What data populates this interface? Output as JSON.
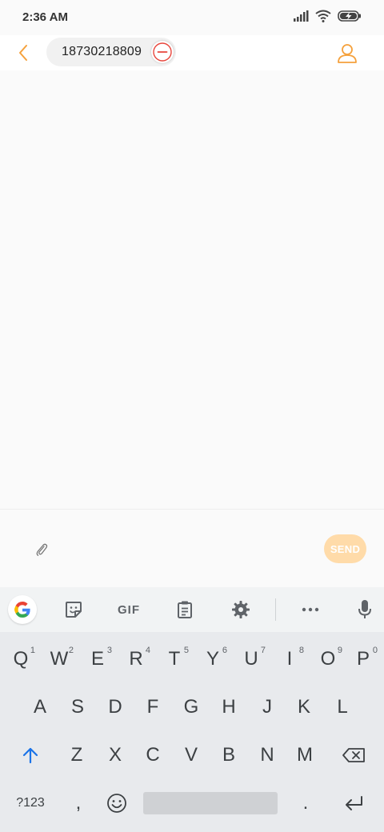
{
  "status_bar": {
    "time": "2:36 AM",
    "icons": [
      "signal-icon",
      "wifi-icon",
      "battery-charging-icon"
    ]
  },
  "header": {
    "back_icon": "chevron-left-icon",
    "recipient": "18730218809",
    "remove_icon": "minus-circle-icon",
    "contact_icon": "person-icon"
  },
  "composer": {
    "attach_icon": "paperclip-icon",
    "message_value": "",
    "send_label": "SEND"
  },
  "keyboard_toolbar": {
    "items": [
      "google-icon",
      "sticker-icon",
      "gif-button",
      "clipboard-icon",
      "gear-icon",
      "more-icon",
      "mic-icon"
    ],
    "gif_label": "GIF"
  },
  "keyboard": {
    "row1": [
      {
        "label": "Q",
        "hint": "1"
      },
      {
        "label": "W",
        "hint": "2"
      },
      {
        "label": "E",
        "hint": "3"
      },
      {
        "label": "R",
        "hint": "4"
      },
      {
        "label": "T",
        "hint": "5"
      },
      {
        "label": "Y",
        "hint": "6"
      },
      {
        "label": "U",
        "hint": "7"
      },
      {
        "label": "I",
        "hint": "8"
      },
      {
        "label": "O",
        "hint": "9"
      },
      {
        "label": "P",
        "hint": "0"
      }
    ],
    "row2": [
      "A",
      "S",
      "D",
      "F",
      "G",
      "H",
      "J",
      "K",
      "L"
    ],
    "row3": [
      "Z",
      "X",
      "C",
      "V",
      "B",
      "N",
      "M"
    ],
    "symbols_label": "?123",
    "comma_label": ",",
    "period_label": "."
  },
  "colors": {
    "accent": "#f5a13c",
    "send_disabled": "#ffdba9",
    "remove_red": "#e8453c",
    "shift_blue": "#1a73e8"
  }
}
